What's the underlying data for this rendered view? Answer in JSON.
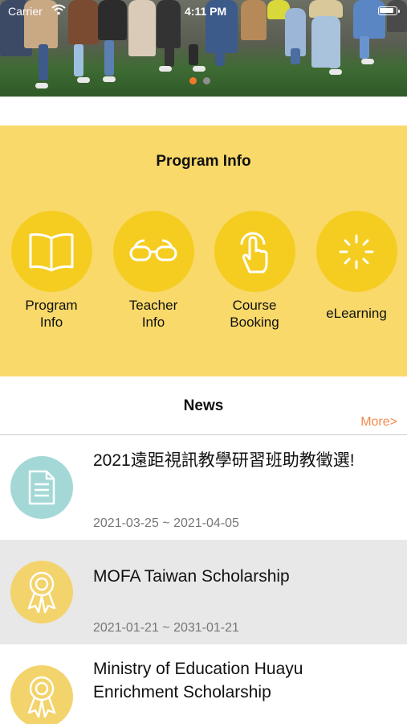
{
  "status_bar": {
    "carrier": "Carrier",
    "time": "4:11 PM"
  },
  "banner": {
    "page_count": 2,
    "active_page": 0
  },
  "program_info": {
    "title": "Program Info",
    "items": [
      {
        "label_line1": "Program",
        "label_line2": "Info",
        "icon": "open-book-icon"
      },
      {
        "label_line1": "Teacher",
        "label_line2": "Info",
        "icon": "glasses-icon"
      },
      {
        "label_line1": "Course",
        "label_line2": "Booking",
        "icon": "tap-hand-icon"
      },
      {
        "label_line1": "eLearning",
        "label_line2": "",
        "icon": "loading-spinner-icon"
      }
    ]
  },
  "news": {
    "title": "News",
    "more_label": "More>",
    "items": [
      {
        "headline": "2021遠距視訊教學研習班助教徵選!",
        "date": "2021-03-25 ~ 2021-04-05",
        "icon": "document-icon"
      },
      {
        "headline": "MOFA Taiwan Scholarship",
        "date": "2021-01-21 ~ 2031-01-21",
        "icon": "award-ribbon-icon"
      },
      {
        "headline": "Ministry of Education Huayu Enrichment Scholarship",
        "date": "",
        "icon": "award-ribbon-icon"
      }
    ]
  },
  "colors": {
    "program_bg": "#f8d96a",
    "circle": "#f5cd21",
    "more_link": "#f08a4b",
    "active_dot": "#f07a2a",
    "doc_icon_bg": "#a3d8d6",
    "award_icon_bg": "#f3d36b"
  }
}
